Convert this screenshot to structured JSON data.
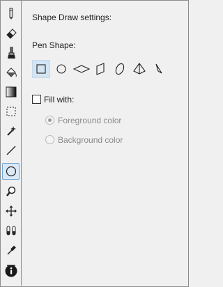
{
  "panel": {
    "title": "Shape Draw settings:",
    "pen_shape_label": "Pen Shape:",
    "pen_shapes": [
      "rectangle",
      "circle",
      "diamond",
      "parallelogram",
      "ellipse",
      "pyramid",
      "triangle"
    ],
    "selected_shape": "rectangle",
    "fill": {
      "label": "Fill with:",
      "checked": false,
      "options": [
        {
          "label": "Foreground color",
          "selected": true
        },
        {
          "label": "Background color",
          "selected": false
        }
      ]
    }
  },
  "toolbar": {
    "tools": [
      "pencil",
      "eraser",
      "brush",
      "fill-bucket",
      "gradient",
      "rectangle-select",
      "magic-wand",
      "line",
      "shape-draw",
      "magnifier",
      "move",
      "clone-stamp",
      "color-picker",
      "text"
    ],
    "selected_tool": "shape-draw"
  },
  "colors": {
    "background": "#f0f0f0",
    "selection": "#d3e4f3",
    "disabled_text": "#8a8a8a"
  }
}
